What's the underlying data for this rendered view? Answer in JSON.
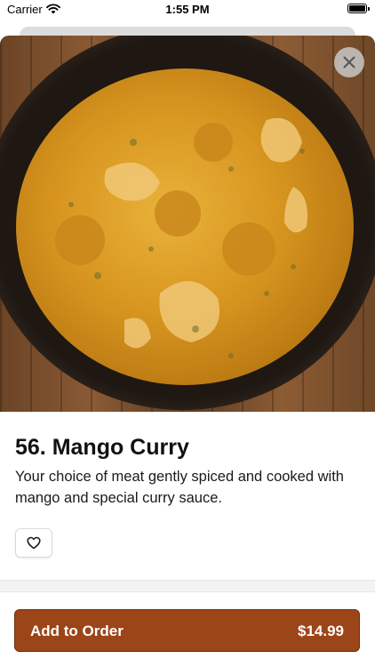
{
  "status_bar": {
    "carrier": "Carrier",
    "time": "1:55 PM"
  },
  "item": {
    "title": "56. Mango Curry",
    "description": "Your choice of meat gently spiced and cooked with mango and special curry sauce."
  },
  "order_button": {
    "label": "Add to Order",
    "price": "$14.99"
  },
  "icons": {
    "close": "close-icon",
    "favorite": "heart-icon",
    "wifi": "wifi-icon",
    "battery": "battery-icon"
  },
  "colors": {
    "accent": "#9c4518",
    "curry": "#e0a22a",
    "wood": "#7a4e2c"
  }
}
